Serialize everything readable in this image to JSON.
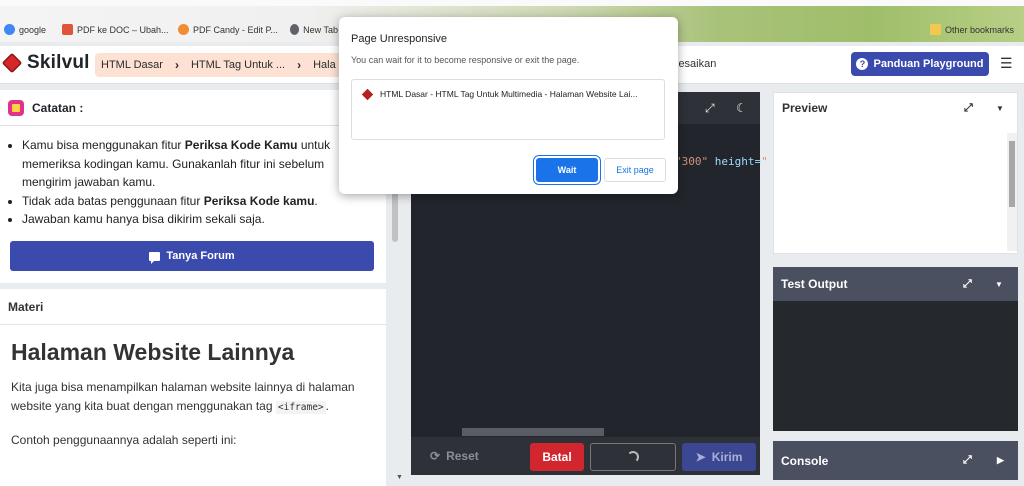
{
  "bookmarks": [
    {
      "label": "google",
      "color": "#4285f4"
    },
    {
      "label": "PDF ke DOC – Ubah...",
      "color": "#e0533d"
    },
    {
      "label": "PDF Candy - Edit P...",
      "color": "#f08d34"
    },
    {
      "label": "New Tab",
      "color": "#5f6368"
    },
    {
      "label": "Other bookmarks",
      "color": "#f2c94c"
    }
  ],
  "header": {
    "logo": "Skilvul",
    "breadcrumbs": [
      "HTML Dasar",
      "HTML Tag Untuk ...",
      "Hala"
    ],
    "status_text": "lesaikan",
    "guide_button": "Panduan Playground"
  },
  "notes": {
    "title": "Catatan :",
    "items": [
      {
        "pre": "Kamu bisa menggunakan fitur ",
        "bold": "Periksa Kode Kamu",
        "post": " untuk memeriksa kodingan kamu. Gunakanlah fitur ini sebelum mengirim jawaban kamu."
      },
      {
        "pre": "Tidak ada batas penggunaan fitur ",
        "bold": "Periksa Kode kamu",
        "post": "."
      },
      {
        "pre": "Jawaban kamu hanya bisa dikirim sekali saja.",
        "bold": "",
        "post": ""
      }
    ],
    "forum_button": "Tanya Forum"
  },
  "materi": {
    "header": "Materi",
    "title": "Halaman Website Lainnya",
    "paragraph1": "Kita juga bisa menampilkan halaman website lainnya di halaman website yang kita buat dengan menggunakan tag",
    "code_tag": "<iframe>",
    "paragraph2": "Contoh penggunaannya adalah seperti ini:"
  },
  "editor": {
    "code_fragment_value": "\"300\"",
    "code_fragment_attr": "height=",
    "reset_label": "Reset",
    "cancel_label": "Batal",
    "submit_label": "Kirim"
  },
  "panels": {
    "preview": "Preview",
    "test_output": "Test Output",
    "console": "Console"
  },
  "dialog": {
    "title": "Page Unresponsive",
    "subtitle": "You can wait for it to become responsive or exit the page.",
    "page_item": "HTML Dasar - HTML Tag Untuk Multimedia - Halaman Website Lai...",
    "wait": "Wait",
    "exit": "Exit page"
  },
  "colors": {
    "primary": "#3b4bad",
    "danger": "#d1262e",
    "editor_bg": "#22262c",
    "dialog_blue": "#1a73e8"
  }
}
